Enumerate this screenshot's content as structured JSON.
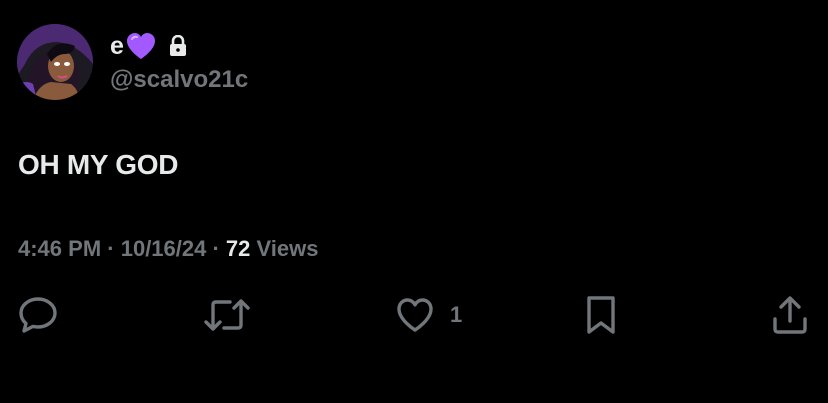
{
  "author": {
    "display_name": "e",
    "name_emoji": "purple-heart",
    "protected_icon": "lock-icon",
    "handle": "@scalvo21c",
    "avatar": "cartoon-character-avatar"
  },
  "tweet": {
    "text": "OH MY GOD"
  },
  "meta": {
    "time": "4:46 PM",
    "separator": " · ",
    "date": "10/16/24",
    "views_count": "72",
    "views_label": " Views"
  },
  "actions": {
    "reply": {
      "icon": "reply-icon"
    },
    "retweet": {
      "icon": "retweet-icon"
    },
    "like": {
      "icon": "heart-icon",
      "count": "1"
    },
    "bookmark": {
      "icon": "bookmark-icon"
    },
    "share": {
      "icon": "share-icon"
    }
  },
  "colors": {
    "background": "#000000",
    "primary_text": "#e7e9ea",
    "secondary_text": "#71767b",
    "heart_emoji": "#a259ff"
  }
}
